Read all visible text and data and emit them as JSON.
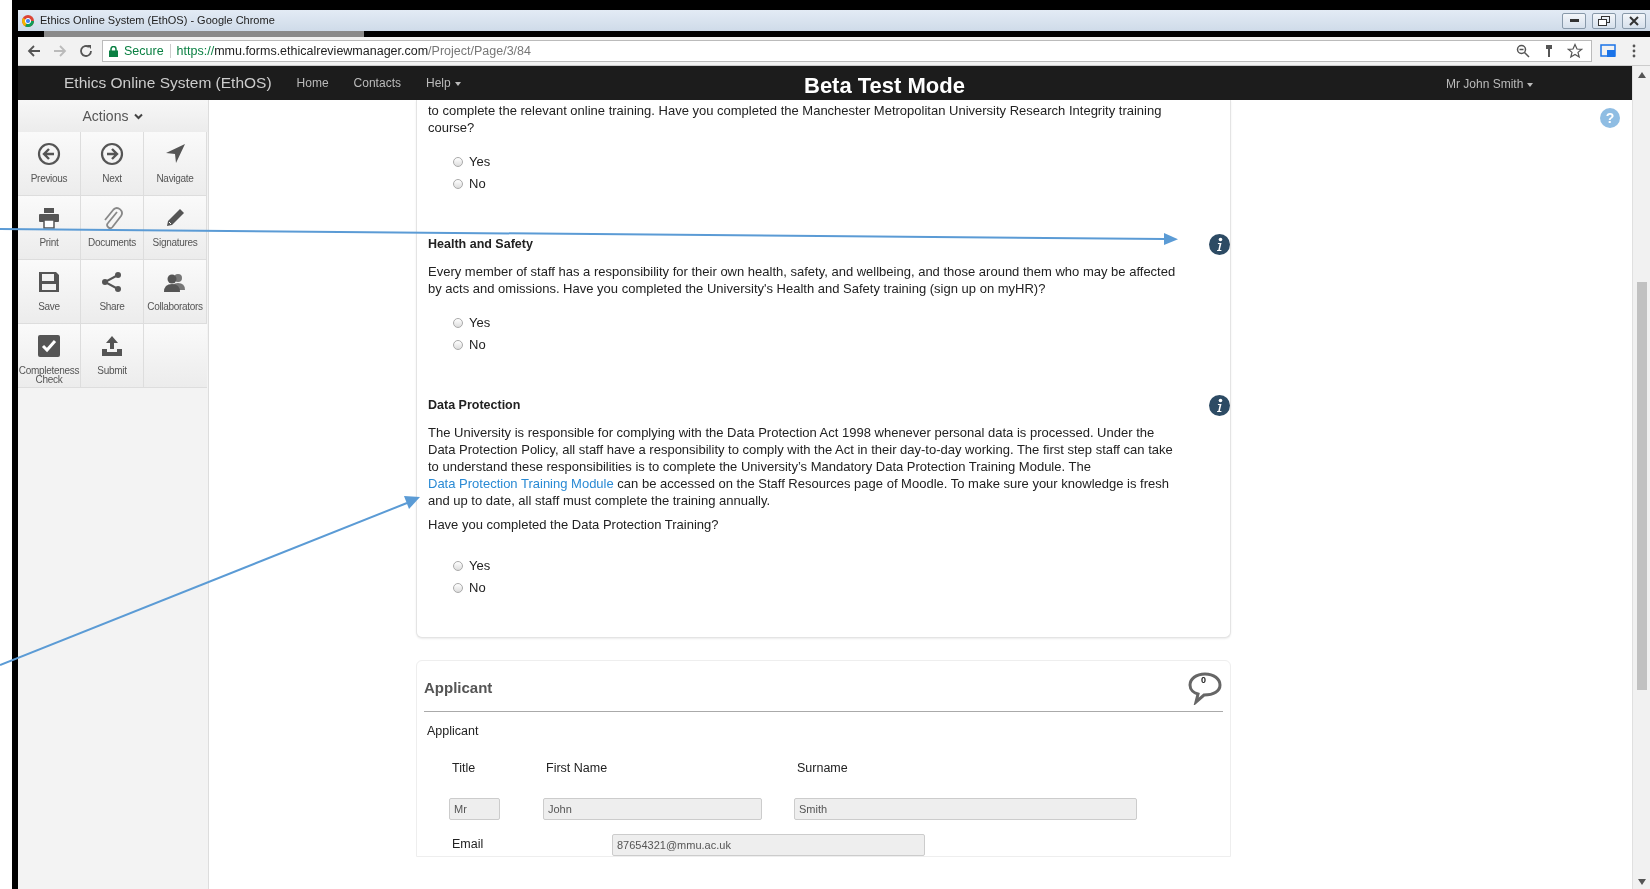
{
  "browser": {
    "title": "Ethics Online System (EthOS) - Google Chrome",
    "secure_label": "Secure",
    "url_scheme": "https://",
    "url_host": "mmu.forms.ethicalreviewmanager.com",
    "url_path": "/Project/Page/3/84"
  },
  "navbar": {
    "brand": "Ethics Online System (EthOS)",
    "links": [
      {
        "label": "Home",
        "dropdown": false
      },
      {
        "label": "Contacts",
        "dropdown": false
      },
      {
        "label": "Help",
        "dropdown": true
      }
    ],
    "banner": "Beta Test Mode",
    "user": {
      "label": "Mr John Smith",
      "dropdown": true
    }
  },
  "help_button": "?",
  "sidebar": {
    "header": "Actions",
    "actions": [
      {
        "label": "Previous"
      },
      {
        "label": "Next"
      },
      {
        "label": "Navigate"
      },
      {
        "label": "Print"
      },
      {
        "label": "Documents"
      },
      {
        "label": "Signatures"
      },
      {
        "label": "Save"
      },
      {
        "label": "Share"
      },
      {
        "label": "Collaborators"
      },
      {
        "label": "Completeness Check"
      },
      {
        "label": "Submit"
      }
    ]
  },
  "questions": [
    {
      "text": "to complete the relevant online training. Have you completed the Manchester Metropolitan University Research Integrity training course?",
      "options": [
        {
          "label": "Yes",
          "selected": false
        },
        {
          "label": "No",
          "selected": false
        }
      ]
    },
    {
      "heading": "Health and Safety",
      "info": true,
      "text": "Every member of staff has a responsibility for their own health, safety, and wellbeing, and those around them who may be affected by acts and omissions. Have you completed the University's Health and Safety training (sign up on myHR)?",
      "options": [
        {
          "label": "Yes",
          "selected": false
        },
        {
          "label": "No",
          "selected": false
        }
      ]
    },
    {
      "heading": "Data Protection",
      "info": true,
      "paragraph": {
        "before": "The University is responsible for complying with the Data Protection Act 1998 whenever personal data is processed. Under the Data Protection Policy, all staff have a responsibility to comply with the Act in their day-to-day working. The first step staff can take to understand these responsibilities is to complete the University’s Mandatory Data Protection Training Module. The ",
        "link": "Data Protection Training Module",
        "after": " can be accessed on the Staff Resources page of Moodle. To make sure your knowledge is fresh and up to date, all staff must complete the training annually."
      },
      "text": "Have you completed the Data Protection Training?",
      "options": [
        {
          "label": "Yes",
          "selected": false
        },
        {
          "label": "No",
          "selected": false
        }
      ]
    }
  ],
  "applicant": {
    "title": "Applicant",
    "comment_count": "0",
    "subheading": "Applicant",
    "name_fields": [
      {
        "label": "Title",
        "value": "Mr"
      },
      {
        "label": "First Name",
        "value": "John"
      },
      {
        "label": "Surname",
        "value": "Smith"
      }
    ],
    "email": {
      "label": "Email",
      "value": "87654321@mmu.ac.uk"
    }
  }
}
